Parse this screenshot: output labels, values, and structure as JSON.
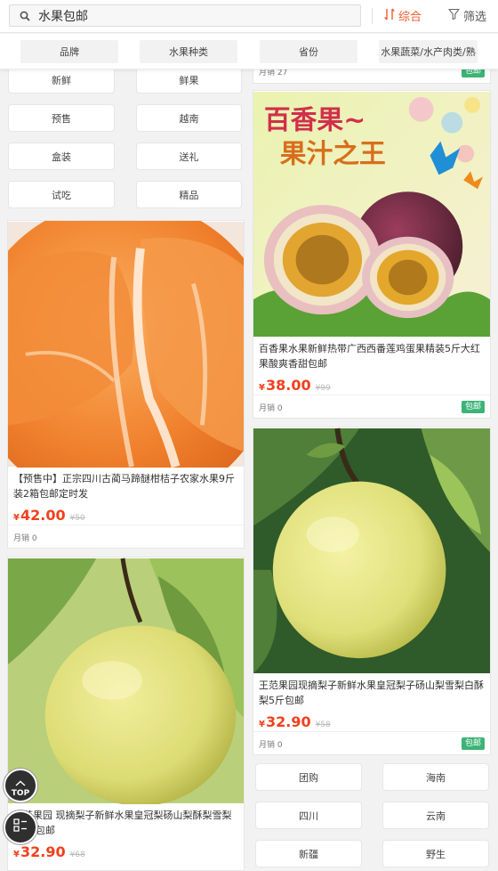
{
  "search": {
    "value": "水果包邮",
    "icon": "search-icon"
  },
  "sort": {
    "label": "综合",
    "icon": "sort-icon",
    "color": "#f25a2a"
  },
  "filter": {
    "label": "筛选",
    "icon": "filter-icon"
  },
  "categories": [
    "品牌",
    "水果种类",
    "省份",
    "水果蔬菜/水产肉类/熟"
  ],
  "tags_left": [
    "新鲜",
    "鲜果",
    "预售",
    "越南",
    "盒装",
    "送礼",
    "试吃",
    "精品"
  ],
  "tags_right": [
    "团购",
    "海南",
    "四川",
    "云南",
    "新疆",
    "野生"
  ],
  "products": [
    {
      "title": "【预售中】正宗四川古蔺马蹄醚柑桔子农家水果9斤装2箱包邮定时发",
      "symbol": "¥",
      "price": "42.00",
      "original": "¥50",
      "sales": "月销 0"
    },
    {
      "title": "百香果水果新鲜热带广西西番莲鸡蛋果精装5斤大红果酸爽香甜包邮",
      "symbol": "¥",
      "price": "38.00",
      "original": "¥99",
      "sales": "月销 0",
      "badge": "包邮"
    },
    {
      "title": "王范果园现摘梨子新鲜水果皇冠梨子砀山梨雪梨白酥梨5斤包邮",
      "symbol": "¥",
      "price": "32.90",
      "original": "¥58",
      "sales": "月销 0",
      "badge": "包邮"
    },
    {
      "title": "王范果园 现摘梨子新鲜水果皇冠梨砀山梨酥梨雪梨10斤包邮",
      "symbol": "¥",
      "price": "32.90",
      "original": "¥68"
    }
  ],
  "partial_top_card": {
    "sales": "月销 27",
    "badge": "包邮"
  },
  "banner_text": {
    "line1": "百香果~",
    "line2": "果汁之王"
  },
  "fab": {
    "top_label": "TOP"
  },
  "colors": {
    "accent": "#f25a2a",
    "price": "#f0411c",
    "badge": "#3bb476"
  }
}
